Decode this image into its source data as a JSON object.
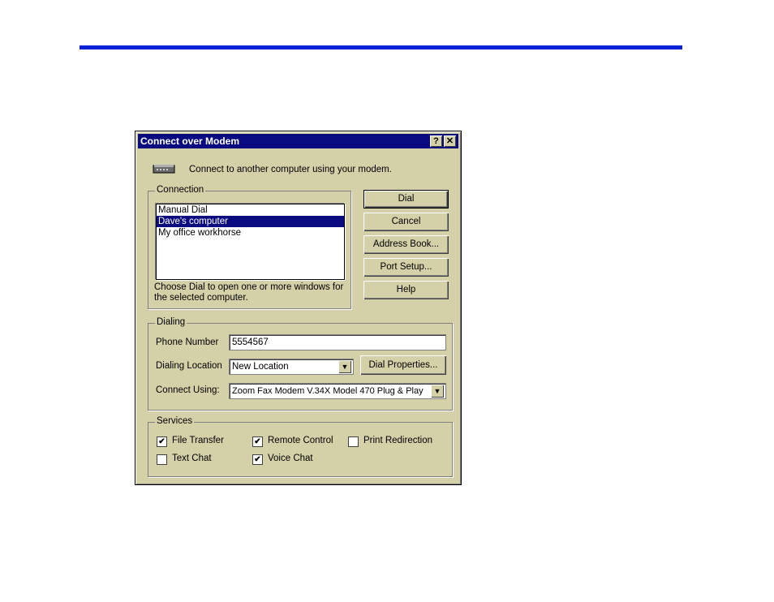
{
  "dialog": {
    "title": "Connect over Modem",
    "help_btn": "?",
    "close_btn": "✕",
    "intro": "Connect to another computer using your modem."
  },
  "connection": {
    "label": "Connection",
    "items": [
      "Manual Dial",
      "Dave's computer",
      "My office workhorse"
    ],
    "selected": "Dave's computer",
    "help_text": "Choose Dial to open one or more windows for the selected computer."
  },
  "buttons": {
    "dial": "Dial",
    "cancel": "Cancel",
    "address_book": "Address Book...",
    "port_setup": "Port Setup...",
    "help": "Help"
  },
  "dialing": {
    "label": "Dialing",
    "phone_label": "Phone Number",
    "phone_value": "5554567",
    "location_label": "Dialing Location",
    "location_value": "New Location",
    "dial_properties": "Dial Properties...",
    "connect_using_label": "Connect Using:",
    "connect_using_value": "Zoom Fax Modem V.34X Model 470 Plug & Play"
  },
  "services": {
    "label": "Services",
    "file_transfer": {
      "label": "File Transfer",
      "checked": true
    },
    "remote_control": {
      "label": "Remote Control",
      "checked": true
    },
    "print_redirection": {
      "label": "Print Redirection",
      "checked": false
    },
    "text_chat": {
      "label": "Text Chat",
      "checked": false
    },
    "voice_chat": {
      "label": "Voice Chat",
      "checked": true
    }
  },
  "colors": {
    "accent_rule": "#0b22d8",
    "title_bar": "#0a0a80",
    "dialog_bg": "#d4d0a8"
  },
  "icons": {
    "modem": "modem-icon",
    "check": "✔",
    "dropdown": "▼"
  }
}
